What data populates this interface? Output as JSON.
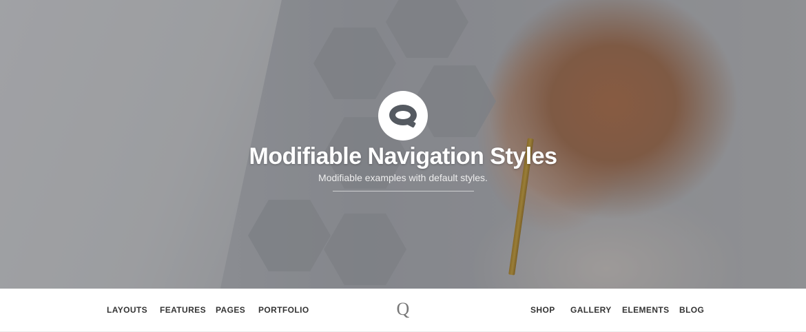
{
  "hero": {
    "logo_icon": "q-logo-icon",
    "title": "Modifiable Navigation Styles",
    "subtitle": "Modifiable examples with default styles."
  },
  "nav": {
    "left_items": [
      "LAYOUTS",
      "FEATURES",
      "PAGES",
      "PORTFOLIO"
    ],
    "logo": "Q",
    "right_items": [
      "SHOP",
      "GALLERY",
      "ELEMENTS",
      "BLOG"
    ]
  },
  "colors": {
    "nav_text": "#333333",
    "hero_text": "#ffffff",
    "overlay": "#2d3037"
  }
}
